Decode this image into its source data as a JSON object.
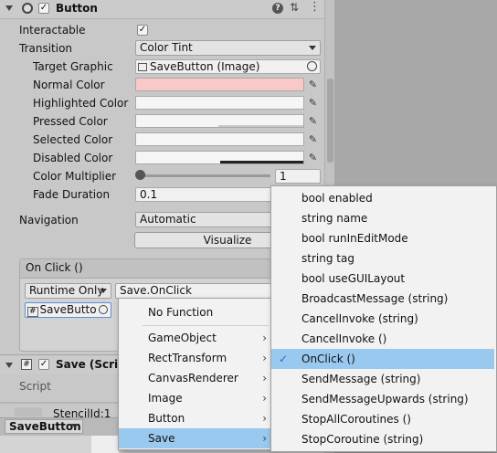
{
  "component": {
    "title": "Button",
    "interactable_label": "Interactable",
    "transition_label": "Transition",
    "transition_value": "Color Tint",
    "target_graphic_label": "Target Graphic",
    "target_graphic_value": "SaveButton (Image)",
    "normal_color_label": "Normal Color",
    "highlighted_color_label": "Highlighted Color",
    "pressed_color_label": "Pressed Color",
    "selected_color_label": "Selected Color",
    "disabled_color_label": "Disabled Color",
    "color_multiplier_label": "Color Multiplier",
    "color_multiplier_value": "1",
    "color_multiplier_fraction": 0.0,
    "fade_duration_label": "Fade Duration",
    "fade_duration_value": "0.1",
    "navigation_label": "Navigation",
    "navigation_value": "Automatic",
    "visualize_label": "Visualize",
    "colors": {
      "normal": "#f9c8c8",
      "highlighted": "#f5f5f5",
      "pressed": "#c8c8c8",
      "selected": "#f5f5f5",
      "disabled": "#c8c8c8"
    }
  },
  "onclick": {
    "header": "On Click ()",
    "runtime_value": "Runtime Only",
    "function_value": "Save.OnClick",
    "object_value": "SaveButto"
  },
  "script_component": {
    "title": "Save (Scrip",
    "script_label": "Script"
  },
  "bottom": {
    "stencil_text": "StencilId:1",
    "object_dropdown": "SaveButton"
  },
  "menu_left": {
    "items": [
      "No Function",
      "GameObject",
      "RectTransform",
      "CanvasRenderer",
      "Image",
      "Button",
      "Save"
    ]
  },
  "menu_right": {
    "items": [
      "bool enabled",
      "string name",
      "bool runInEditMode",
      "string tag",
      "bool useGUILayout",
      "BroadcastMessage (string)",
      "CancelInvoke (string)",
      "CancelInvoke ()",
      "OnClick ()",
      "SendMessage (string)",
      "SendMessageUpwards (string)",
      "StopAllCoroutines ()",
      "StopCoroutine (string)"
    ],
    "selected": "OnClick ()"
  }
}
